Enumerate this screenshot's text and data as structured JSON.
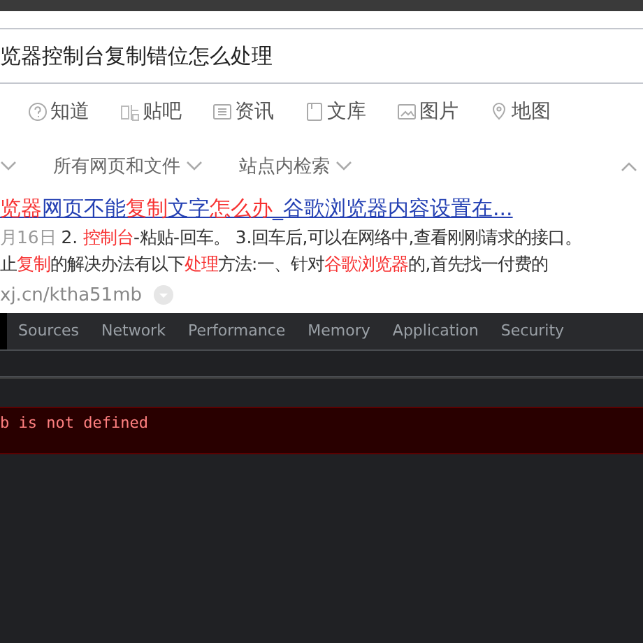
{
  "search": {
    "value": "览器控制台复制错位怎么处理"
  },
  "nav_tabs": [
    {
      "label": "知道"
    },
    {
      "label": "贴吧"
    },
    {
      "label": "资讯"
    },
    {
      "label": "文库"
    },
    {
      "label": "图片"
    },
    {
      "label": "地图"
    }
  ],
  "filters": [
    {
      "label": "所有网页和文件"
    },
    {
      "label": "站点内检索"
    }
  ],
  "result": {
    "title": [
      {
        "text": "览器",
        "highlight": true
      },
      {
        "text": "网页不能",
        "highlight": false
      },
      {
        "text": "复制",
        "highlight": true
      },
      {
        "text": "文字",
        "highlight": false
      },
      {
        "text": "怎么办",
        "highlight": true
      },
      {
        "text": "_谷歌浏览器内容设置在...",
        "highlight": false
      }
    ],
    "date": "月16日",
    "snippet_lines": [
      [
        {
          "text": "2. ",
          "highlight": false
        },
        {
          "text": "控制台",
          "highlight": true
        },
        {
          "text": "-粘贴-回车。 3.回车后,可以在网络中,查看刚刚请求的接口。",
          "highlight": false
        }
      ],
      [
        {
          "text": "止",
          "highlight": false
        },
        {
          "text": "复制",
          "highlight": true
        },
        {
          "text": "的解决办法有以下",
          "highlight": false
        },
        {
          "text": "处理",
          "highlight": true
        },
        {
          "text": "方法:一、针对",
          "highlight": false
        },
        {
          "text": "谷歌浏览器",
          "highlight": true
        },
        {
          "text": "的,首先找一付费的",
          "highlight": false
        }
      ]
    ],
    "url": "xj.cn/ktha51mb"
  },
  "devtools": {
    "tabs": [
      {
        "label": "Sources",
        "selected": false
      },
      {
        "label": "Network",
        "selected": false
      },
      {
        "label": "Performance",
        "selected": false
      },
      {
        "label": "Memory",
        "selected": false
      },
      {
        "label": "Application",
        "selected": false
      },
      {
        "label": "Security",
        "selected": false
      }
    ],
    "console_error": "b is not defined"
  }
}
